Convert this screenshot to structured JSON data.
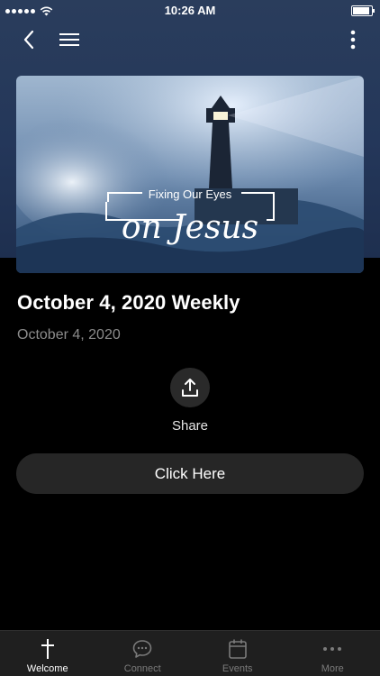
{
  "status_bar": {
    "time": "10:26 AM",
    "signal_icon": "signal-dots-icon",
    "wifi_icon": "wifi-icon",
    "battery_icon": "battery-icon"
  },
  "nav": {
    "back_icon": "chevron-left-icon",
    "menu_icon": "hamburger-menu-icon",
    "more_icon": "vertical-ellipsis-icon"
  },
  "hero": {
    "image": "lighthouse-storm-graphic",
    "overlay_line1": "Fixing Our Eyes",
    "overlay_line2": "on Jesus"
  },
  "content": {
    "title": "October 4, 2020 Weekly",
    "date": "October 4, 2020",
    "share_label": "Share",
    "share_icon": "share-upload-icon",
    "button_label": "Click Here"
  },
  "tabs": [
    {
      "label": "Welcome",
      "icon": "cross-icon",
      "active": true
    },
    {
      "label": "Connect",
      "icon": "chat-bubble-icon",
      "active": false
    },
    {
      "label": "Events",
      "icon": "calendar-icon",
      "active": false
    },
    {
      "label": "More",
      "icon": "horizontal-ellipsis-icon",
      "active": false
    }
  ],
  "colors": {
    "header_bg": "#24375a",
    "page_bg": "#000000",
    "tab_bar_bg": "#1f1f1f",
    "button_bg": "#262626"
  }
}
